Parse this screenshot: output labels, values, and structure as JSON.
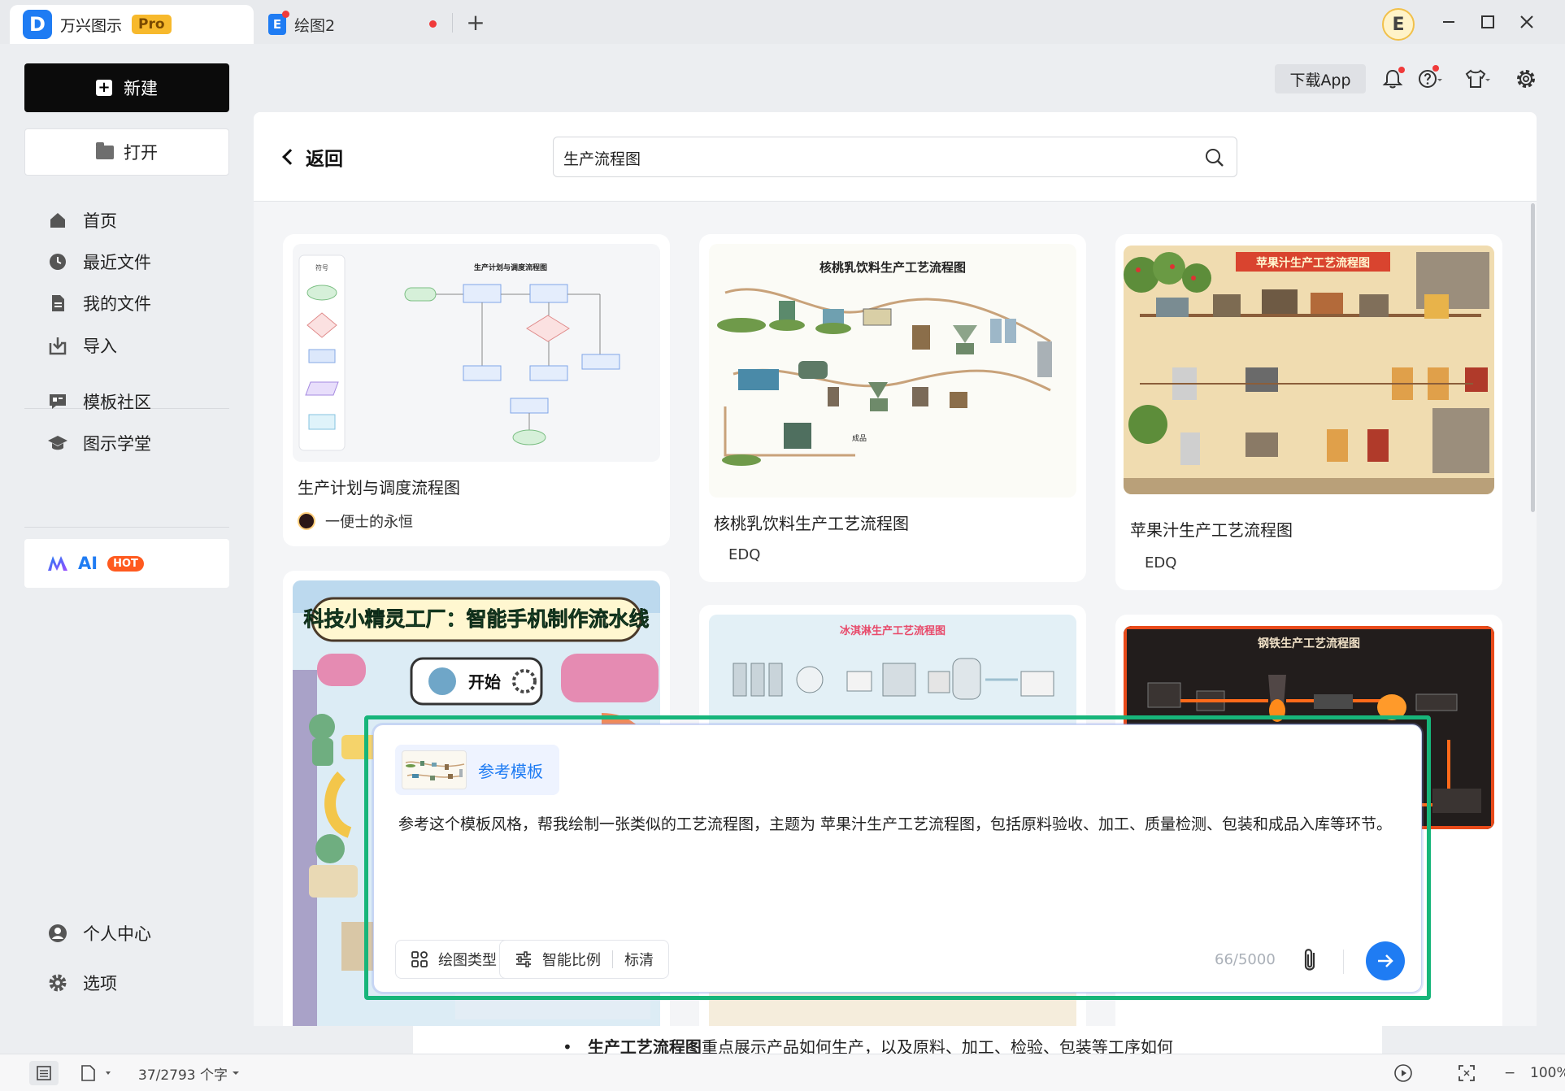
{
  "titlebar": {
    "app_name": "万兴图示",
    "pro_badge": "Pro",
    "tab2_label": "绘图2",
    "logo_letter": "D",
    "tab2_letter": "E",
    "avatar_letter": "E",
    "add_tab_label": "+"
  },
  "sidebar": {
    "new_label": "新建",
    "open_label": "打开",
    "items": [
      {
        "label": "首页",
        "icon": "home-icon"
      },
      {
        "label": "最近文件",
        "icon": "clock-icon"
      },
      {
        "label": "我的文件",
        "icon": "file-icon"
      },
      {
        "label": "导入",
        "icon": "import-icon"
      },
      {
        "label": "模板社区",
        "icon": "community-icon"
      },
      {
        "label": "图示学堂",
        "icon": "graduation-cap-icon"
      }
    ],
    "ai_label": "AI",
    "ai_badge": "HOT",
    "personal_center": "个人中心",
    "options": "选项"
  },
  "toolbar": {
    "download_app": "下载App"
  },
  "main": {
    "back_label": "返回",
    "search_value": "生产流程图"
  },
  "cards": [
    {
      "title": "生产计划与调度流程图",
      "author": "一便士的永恒",
      "thumb_title": "生产计划与调度流程图",
      "thumb_sidebar_label": "符号"
    },
    {
      "title": "核桃乳饮料生产工艺流程图",
      "author": "EDQ",
      "thumb_title": "核桃乳饮料生产工艺流程图"
    },
    {
      "title": "苹果汁生产工艺流程图",
      "author": "EDQ",
      "thumb_title": "苹果汁生产工艺流程图"
    },
    {
      "title": "",
      "author": "",
      "thumb_title": "科技小精灵工厂：智能手机制作流水线",
      "thumb_button": "开始"
    },
    {
      "title": "",
      "author": "",
      "thumb_title": "冰淇淋生产工艺流程图"
    },
    {
      "title": "",
      "author": "",
      "thumb_title": "钢铁生产工艺流程图"
    }
  ],
  "prompt": {
    "ref_label": "参考模板",
    "text": "参考这个模板风格，帮我绘制一张类似的工艺流程图，主题为 苹果汁生产工艺流程图，包括原料验收、加工、质量检测、包装和成品入库等环节。",
    "draw_type": "绘图类型",
    "smart_ratio": "智能比例",
    "ratio_value": "标清",
    "counter": "66/5000"
  },
  "doc": {
    "bullet": "•",
    "bold": "生产工艺流程图",
    "rest": "重点展示产品如何生产，以及原料、加工、检验、包装等工序如何"
  },
  "status": {
    "word_count": "37/2793 个字",
    "zoom": "100%",
    "zoom_minus": "−"
  },
  "colors": {
    "accent": "#1f7cf3",
    "highlight_border": "#17b57a",
    "hot": "#ff5a1f",
    "pro": "#f7b92c"
  }
}
